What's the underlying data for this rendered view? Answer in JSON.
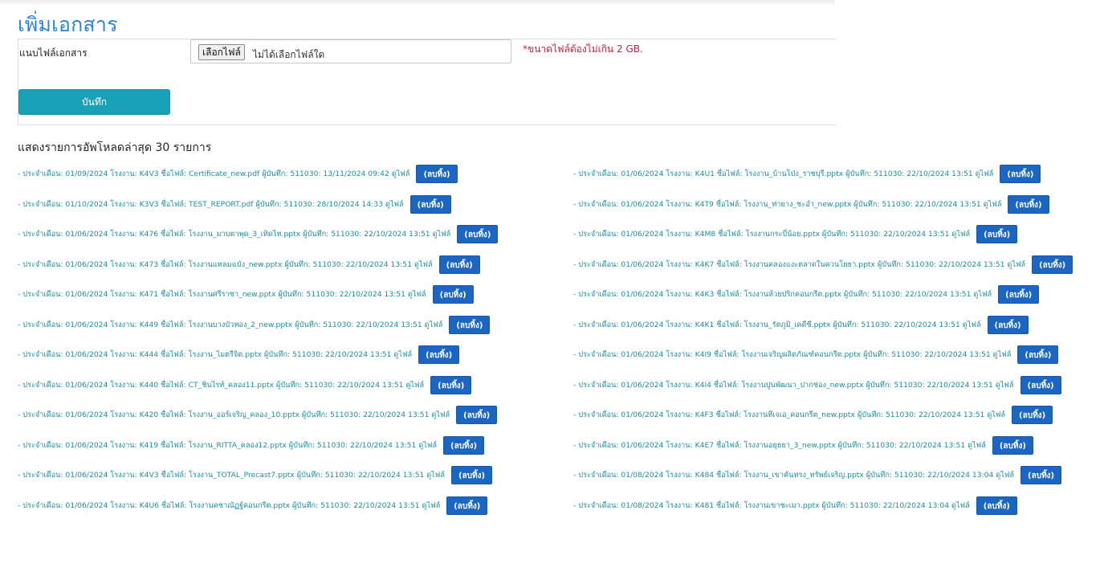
{
  "page": {
    "title": "เพิ่มเอกสาร",
    "attach_label": "แนบไฟล์เอกสาร",
    "choose_file_label": "เลือกไฟล์",
    "no_file_text": "ไม่ได้เลือกไฟล์ใด",
    "size_note": "*ขนาดไฟล์ต้องไม่เกิน 2 GB.",
    "save_label": "บันทึก",
    "list_heading": "แสดงรายการอัพโหลดล่าสุด 30 รายการ",
    "view_label": "ดูไฟล์",
    "delete_label": "(ลบทิ้ง)"
  },
  "uploads_left": [
    "- ประจำเดือน: 01/09/2024 โรงงาน: K4V3 ชื่อไฟล์: Certificate_new.pdf ผู้บันทึก: 511030: 13/11/2024 09:42",
    "- ประจำเดือน: 01/10/2024 โรงงาน: K3V3 ชื่อไฟล์: TEST_REPORT.pdf ผู้บันทึก: 511030: 28/10/2024 14:33",
    "- ประจำเดือน: 01/06/2024 โรงงาน: K476 ชื่อไฟล์: โรงงาน_มาบตาพุด_3_เทิดไท.pptx ผู้บันทึก: 511030: 22/10/2024 13:51",
    "- ประจำเดือน: 01/06/2024 โรงงาน: K473 ชื่อไฟล์: โรงงานแหลมฉบัง_new.pptx ผู้บันทึก: 511030: 22/10/2024 13:51",
    "- ประจำเดือน: 01/06/2024 โรงงาน: K471 ชื่อไฟล์: โรงงานศรีราชา_new.pptx ผู้บันทึก: 511030: 22/10/2024 13:51",
    "- ประจำเดือน: 01/06/2024 โรงงาน: K449 ชื่อไฟล์: โรงงานบางบัวทอง_2_new.pptx ผู้บันทึก: 511030: 22/10/2024 13:51",
    "- ประจำเดือน: 01/06/2024 โรงงาน: K444 ชื่อไฟล์: โรงงาน_ไมตรีจิต.pptx ผู้บันทึก: 511030: 22/10/2024 13:51",
    "- ประจำเดือน: 01/06/2024 โรงงาน: K440 ชื่อไฟล์: CT_ชินไรท์_คลอง11.pptx ผู้บันทึก: 511030: 22/10/2024 13:51",
    "- ประจำเดือน: 01/06/2024 โรงงาน: K420 ชื่อไฟล์: โรงงาน_ออร์เจริญ_คลอง_10.pptx ผู้บันทึก: 511030: 22/10/2024 13:51",
    "- ประจำเดือน: 01/06/2024 โรงงาน: K419 ชื่อไฟล์: โรงงาน_RITTA_คลอง12.pptx ผู้บันทึก: 511030: 22/10/2024 13:51",
    "- ประจำเดือน: 01/06/2024 โรงงาน: K4V3 ชื่อไฟล์: โรงงาน_TOTAL_Precast7.pptx ผู้บันทึก: 511030: 22/10/2024 13:51",
    "- ประจำเดือน: 01/06/2024 โรงงาน: K4U6 ชื่อไฟล์: โรงงานคชาณัฏฐ์คอนกรีต.pptx ผู้บันทึก: 511030: 22/10/2024 13:51"
  ],
  "uploads_right": [
    "- ประจำเดือน: 01/06/2024 โรงงาน: K4U1 ชื่อไฟล์: โรงงาน_บ้านโป่ง_ราชบุรี.pptx ผู้บันทึก: 511030: 22/10/2024 13:51",
    "- ประจำเดือน: 01/06/2024 โรงงาน: K4T9 ชื่อไฟล์: โรงงาน_ท่ายาง_ชะอำ_new.pptx ผู้บันทึก: 511030: 22/10/2024 13:51",
    "- ประจำเดือน: 01/06/2024 โรงงาน: K4M8 ชื่อไฟล์: โรงงานกระบี่น้อย.pptx ผู้บันทึก: 511030: 22/10/2024 13:51",
    "- ประจำเดือน: 01/06/2024 โรงงาน: K4K7 ชื่อไฟล์: โรงงานคลองแงะตลาดในควนโยธา.pptx ผู้บันทึก: 511030: 22/10/2024 13:51",
    "- ประจำเดือน: 01/06/2024 โรงงาน: K4K3 ชื่อไฟล์: โรงงานห้วยปริกคอนกรีต.pptx ผู้บันทึก: 511030: 22/10/2024 13:51",
    "- ประจำเดือน: 01/06/2024 โรงงาน: K4K1 ชื่อไฟล์: โรงงาน_รัตภูมิ_เคดีซี.pptx ผู้บันทึก: 511030: 22/10/2024 13:51",
    "- ประจำเดือน: 01/06/2024 โรงงาน: K4I9 ชื่อไฟล์: โรงงานเจริญผลิตภัณฑ์คอนกรีต.pptx ผู้บันทึก: 511030: 22/10/2024 13:51",
    "- ประจำเดือน: 01/06/2024 โรงงาน: K4I4 ชื่อไฟล์: โรงงานปูนพัฒนา_ปากช่อง_new.pptx ผู้บันทึก: 511030: 22/10/2024 13:51",
    "- ประจำเดือน: 01/06/2024 โรงงาน: K4F3 ชื่อไฟล์: โรงงานทีเจเอ_คอนกรีต_new.pptx ผู้บันทึก: 511030: 22/10/2024 13:51",
    "- ประจำเดือน: 01/06/2024 โรงงาน: K4E7 ชื่อไฟล์: โรงงานอยุธยา_3_new.pptx ผู้บันทึก: 511030: 22/10/2024 13:51",
    "- ประจำเดือน: 01/08/2024 โรงงาน: K484 ชื่อไฟล์: โรงงาน_เขาคันทรง_ทรัพย์เจริญ.pptx ผู้บันทึก: 511030: 22/10/2024 13:04",
    "- ประจำเดือน: 01/08/2024 โรงงาน: K481 ชื่อไฟล์: โรงงานเขาชะเมา.pptx ผู้บันทึก: 511030: 22/10/2024 13:04"
  ]
}
